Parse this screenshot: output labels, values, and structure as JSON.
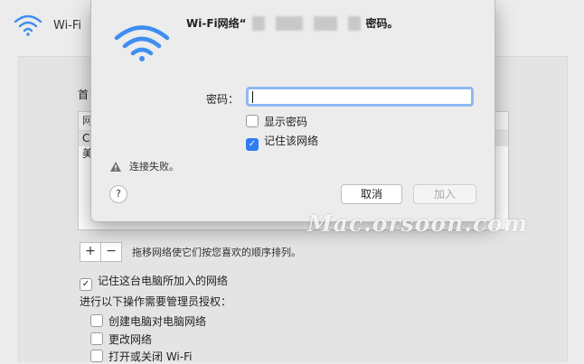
{
  "app": {
    "wifi_label": "Wi-Fi"
  },
  "background_window": {
    "preferred_networks_title_visible": "首",
    "list_header_visible": "网",
    "list_rows": [
      "Cl",
      "美"
    ],
    "add_button": "+",
    "remove_button": "−",
    "drag_hint": "拖移网络使它们按您喜欢的顺序排列。",
    "remember_networks_label": "记住这台电脑所加入的网络",
    "remember_networks_checked": true,
    "admin_required_title": "进行以下操作需要管理员授权：",
    "admin_options": [
      {
        "label": "创建电脑对电脑网络",
        "checked": false
      },
      {
        "label": "更改网络",
        "checked": false
      },
      {
        "label": "打开或关闭 Wi-Fi",
        "checked": false
      }
    ]
  },
  "dialog": {
    "title_prefix": "Wi-Fi网络“",
    "title_suffix": "密码。",
    "password_label": "密码：",
    "password_value": "",
    "show_password_label": "显示密码",
    "show_password_checked": false,
    "remember_network_label": "记住该网络",
    "remember_network_checked": true,
    "error_text": "连接失败。",
    "help_label": "?",
    "cancel_label": "取消",
    "join_label": "加入",
    "accent_color": "#2f7df6"
  },
  "watermark": "Mac.orsoon.com"
}
